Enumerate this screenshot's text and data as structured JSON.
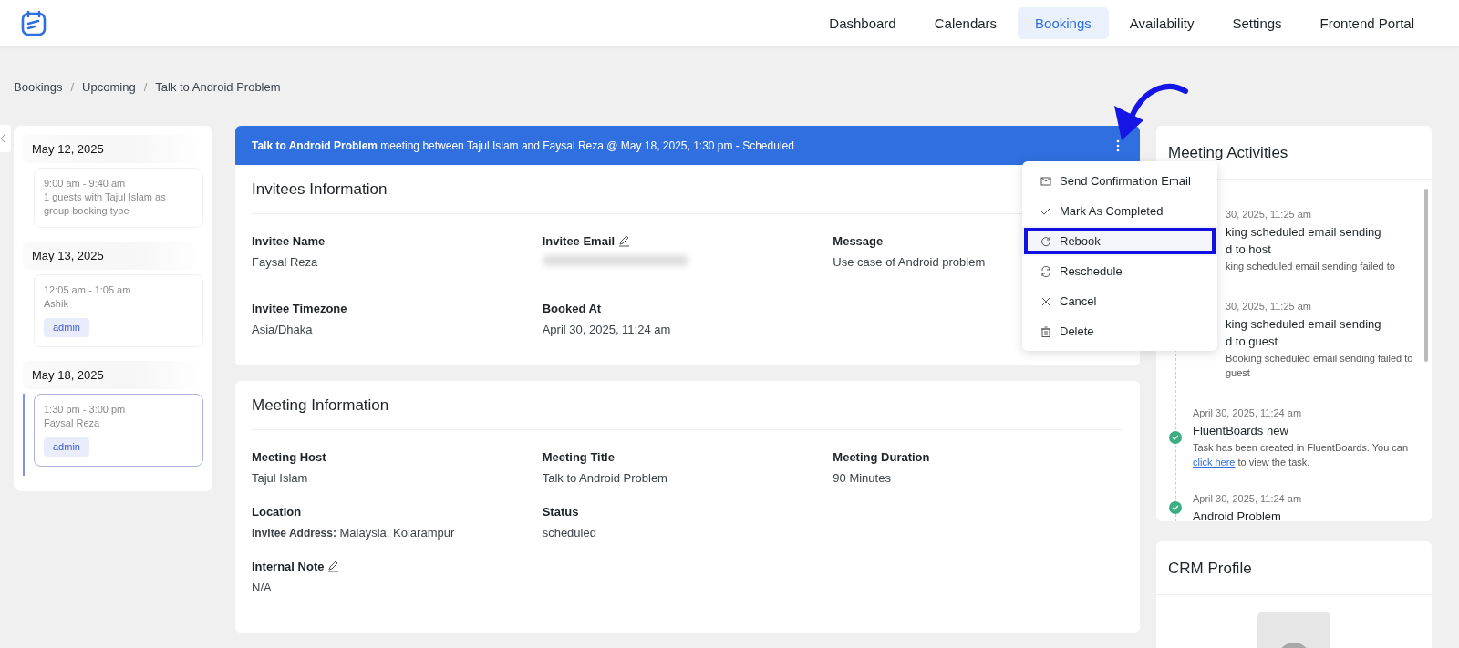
{
  "nav": [
    {
      "label": "Dashboard",
      "selected": false
    },
    {
      "label": "Calendars",
      "selected": false
    },
    {
      "label": "Bookings",
      "selected": true
    },
    {
      "label": "Availability",
      "selected": false
    },
    {
      "label": "Settings",
      "selected": false
    },
    {
      "label": "Frontend Portal",
      "selected": false
    }
  ],
  "breadcrumb": [
    "Bookings",
    "Upcoming",
    "Talk to Android Problem"
  ],
  "breadcrumb_separator": "/",
  "bookings_list": [
    {
      "date": "May 12, 2025",
      "items": [
        {
          "time": "9:00 am - 9:40 am",
          "text": "1 guests with Tajul Islam as group booking type",
          "selected": false
        }
      ]
    },
    {
      "date": "May 13, 2025",
      "items": [
        {
          "time": "12:05 am - 1:05 am",
          "text": "Ashik",
          "tag": "admin",
          "selected": false
        }
      ]
    },
    {
      "date": "May 18, 2025",
      "items": [
        {
          "time": "1:30 pm - 3:00 pm",
          "text": "Faysal Reza",
          "tag": "admin",
          "selected": true
        }
      ]
    }
  ],
  "booking": {
    "header": "**Talk to Android Problem** meeting between Tajul Islam and Faysal Reza @ May 18, 2025, 1:30 pm - Scheduled",
    "menu": [
      {
        "label": "Send Confirmation Email",
        "kind": "mail",
        "selected": false
      },
      {
        "label": "Mark As Completed",
        "kind": "check",
        "selected": false
      },
      {
        "label": "Rebook",
        "kind": "rebook",
        "selected": true
      },
      {
        "label": "Reschedule",
        "kind": "reschedule",
        "selected": false
      },
      {
        "label": "Cancel",
        "kind": "cancel",
        "selected": false
      },
      {
        "label": "Delete",
        "kind": "delete",
        "selected": false
      }
    ],
    "sections": [
      {
        "title": "Invitees Information",
        "fields": [
          {
            "label": "Invitee Name",
            "value": "Faysal Reza",
            "kind": "text"
          },
          {
            "label": "Invitee Email",
            "kind": "redacted",
            "editable": true
          },
          {
            "label": "Message",
            "value": "Use case of Android problem",
            "kind": "text"
          },
          {
            "label": "Invitee Timezone",
            "value": "Asia/Dhaka",
            "kind": "text"
          },
          {
            "label": "Booked At",
            "value": "April 30, 2025, 11:24 am",
            "kind": "text"
          }
        ]
      },
      {
        "title": "Meeting Information",
        "fields": [
          {
            "label": "Meeting Host",
            "value": "Tajul Islam",
            "kind": "text"
          },
          {
            "label": "Meeting Title",
            "value": "Talk to Android Problem",
            "kind": "text"
          },
          {
            "label": "Meeting Duration",
            "value": "90 Minutes",
            "kind": "text"
          },
          {
            "label": "Location",
            "value": "**Invitee Address:** Malaysia, Kolarampur",
            "kind": "rich"
          },
          {
            "label": "Status",
            "value": "scheduled",
            "kind": "text"
          },
          {
            "label": "Internal Note",
            "value": "N/A",
            "kind": "text",
            "editable": true,
            "new_row": true
          }
        ]
      }
    ]
  },
  "activities": {
    "title": "Meeting Activities",
    "items": [
      {
        "date": "30, 2025, 11:25 am",
        "title": [
          "king scheduled email sending",
          "d to host"
        ],
        "description": "king scheduled email sending failed to",
        "covered": true
      },
      {
        "date": "30, 2025, 11:25 am",
        "title": [
          "king scheduled email sending",
          "d to guest"
        ],
        "description": "Booking scheduled email sending failed to guest",
        "covered": true
      },
      {
        "date": "April 30, 2025, 11:24 am",
        "title": [
          "FluentBoards new"
        ],
        "description": "Task has been created in FluentBoards. You can ",
        "link": "click here",
        "description_after": " to view the task.",
        "covered": false
      },
      {
        "date": "April 30, 2025, 11:24 am",
        "title": [
          "Android Problem"
        ],
        "covered": false
      }
    ]
  },
  "crm": {
    "title": "CRM Profile"
  }
}
